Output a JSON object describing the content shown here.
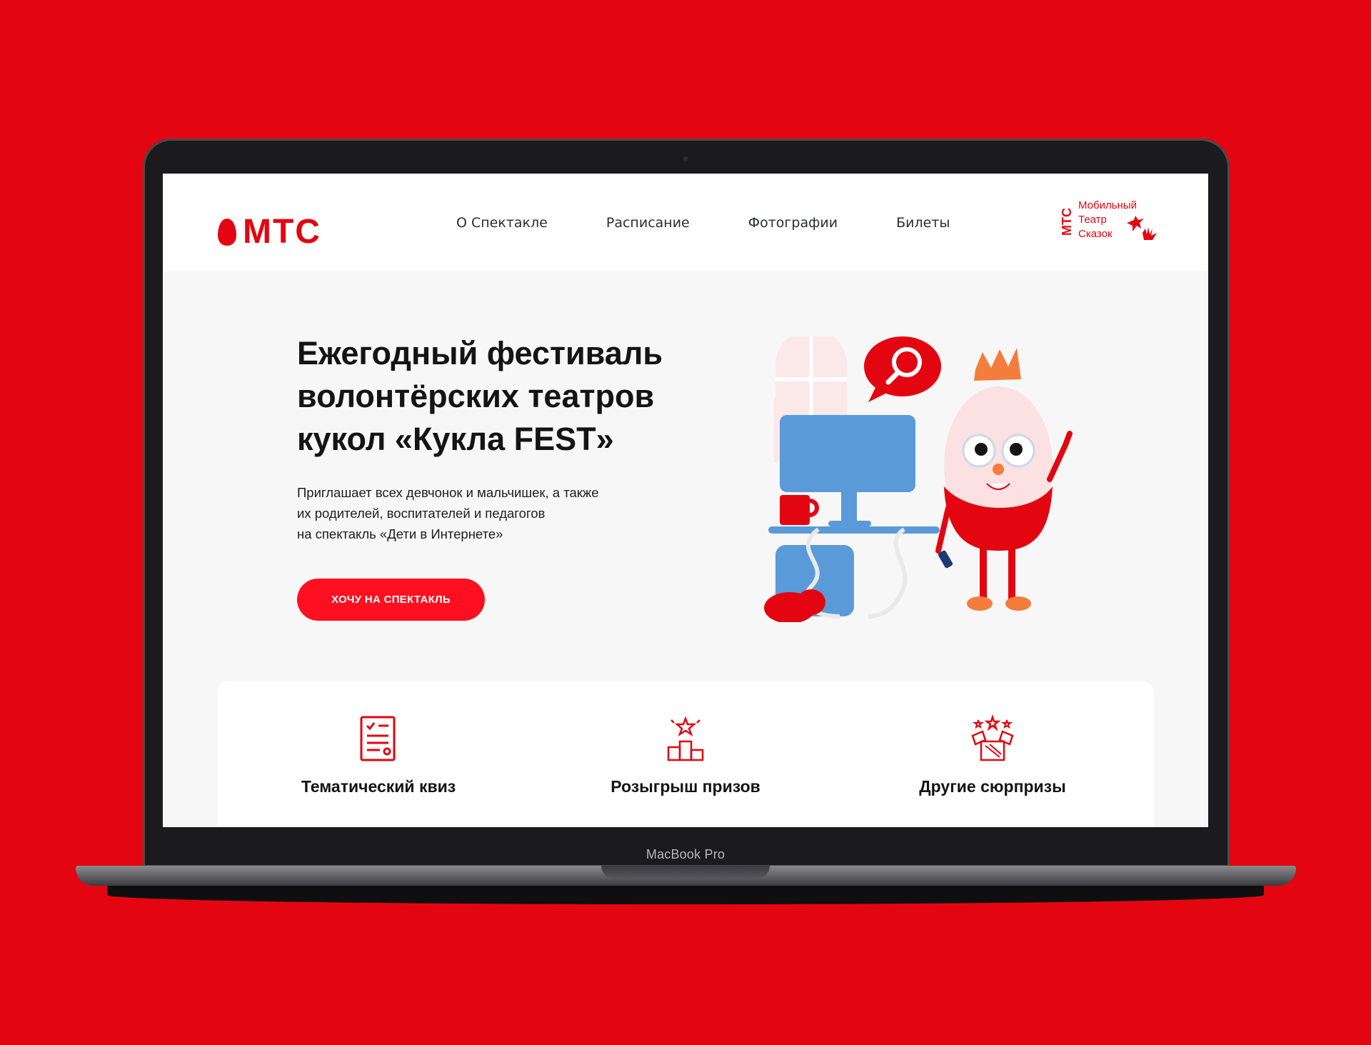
{
  "device": {
    "model_label": "MacBook Pro"
  },
  "header": {
    "logo_text": "МТС",
    "nav": [
      "О Спектакле",
      "Расписание",
      "Фотографии",
      "Билеты"
    ],
    "brand": {
      "vertical": "МТС",
      "lines": [
        "Мобильный",
        "Театр",
        "Сказок"
      ]
    }
  },
  "hero": {
    "title_lines": [
      "Ежегодный фестиваль",
      "волонтёрских театров",
      "кукол «Кукла FEST»"
    ],
    "subtitle_lines": [
      "Приглашает всех девчонок и мальчишек, а также",
      "их родителей, воспитателей и педагогов",
      "на спектакль «Дети в Интернете»"
    ],
    "cta_label": "ХОЧУ НА СПЕКТАКЛЬ"
  },
  "features": [
    {
      "label": "Тематический квиз",
      "icon": "quiz-checklist-icon"
    },
    {
      "label": "Розыгрыш призов",
      "icon": "prize-podium-icon"
    },
    {
      "label": "Другие сюрпризы",
      "icon": "gift-box-icon"
    }
  ],
  "colors": {
    "brand_red": "#e30611",
    "cta_red": "#ff0f1f",
    "screen_bg": "#f7f7f7",
    "monitor_blue": "#5b9ad9"
  }
}
